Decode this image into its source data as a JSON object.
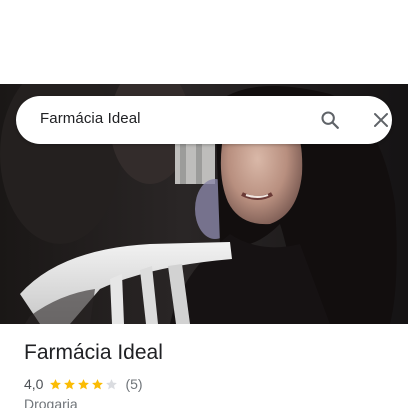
{
  "search": {
    "query": "Farmácia Ideal"
  },
  "place": {
    "name": "Farmácia Ideal",
    "rating": "4,0",
    "rating_stars": 4,
    "rating_max": 5,
    "review_count": "(5)",
    "category": "Drogaria"
  },
  "colors": {
    "star_filled": "#fbbc04",
    "star_empty": "#dadce0",
    "icon": "#5f6368"
  },
  "icons": {
    "search": "search-icon",
    "close": "close-icon"
  }
}
